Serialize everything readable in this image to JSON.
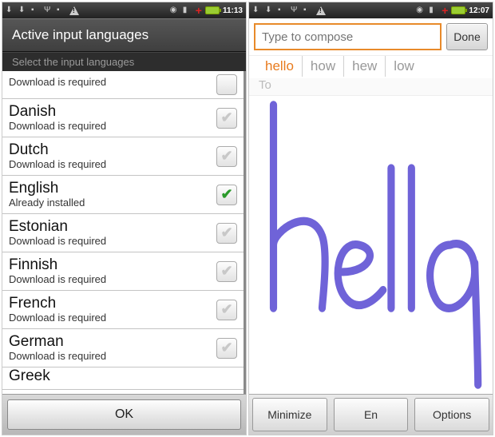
{
  "phoneA": {
    "status": {
      "time": "11:13"
    },
    "dialog": {
      "title": "Active input languages",
      "subtitle": "Select the input languages",
      "ok_label": "OK"
    },
    "languages": [
      {
        "name": "",
        "status": "Download is required",
        "state": "partial_top"
      },
      {
        "name": "Danish",
        "status": "Download is required",
        "state": "unchecked"
      },
      {
        "name": "Dutch",
        "status": "Download is required",
        "state": "unchecked"
      },
      {
        "name": "English",
        "status": "Already installed",
        "state": "checked"
      },
      {
        "name": "Estonian",
        "status": "Download is required",
        "state": "unchecked"
      },
      {
        "name": "Finnish",
        "status": "Download is required",
        "state": "unchecked"
      },
      {
        "name": "French",
        "status": "Download is required",
        "state": "unchecked"
      },
      {
        "name": "German",
        "status": "Download is required",
        "state": "unchecked"
      },
      {
        "name": "Greek",
        "status": "",
        "state": "partial_bottom"
      }
    ]
  },
  "phoneB": {
    "status": {
      "time": "12:07"
    },
    "compose": {
      "placeholder": "Type to compose",
      "done_label": "Done",
      "to_label": "To"
    },
    "suggestions": [
      {
        "text": "hello",
        "selected": true
      },
      {
        "text": "how",
        "selected": false
      },
      {
        "text": "hew",
        "selected": false
      },
      {
        "text": "low",
        "selected": false
      }
    ],
    "keyboard": {
      "minimize": "Minimize",
      "lang": "En",
      "options": "Options"
    },
    "handwriting_stroke_color": "#6f63d8"
  }
}
